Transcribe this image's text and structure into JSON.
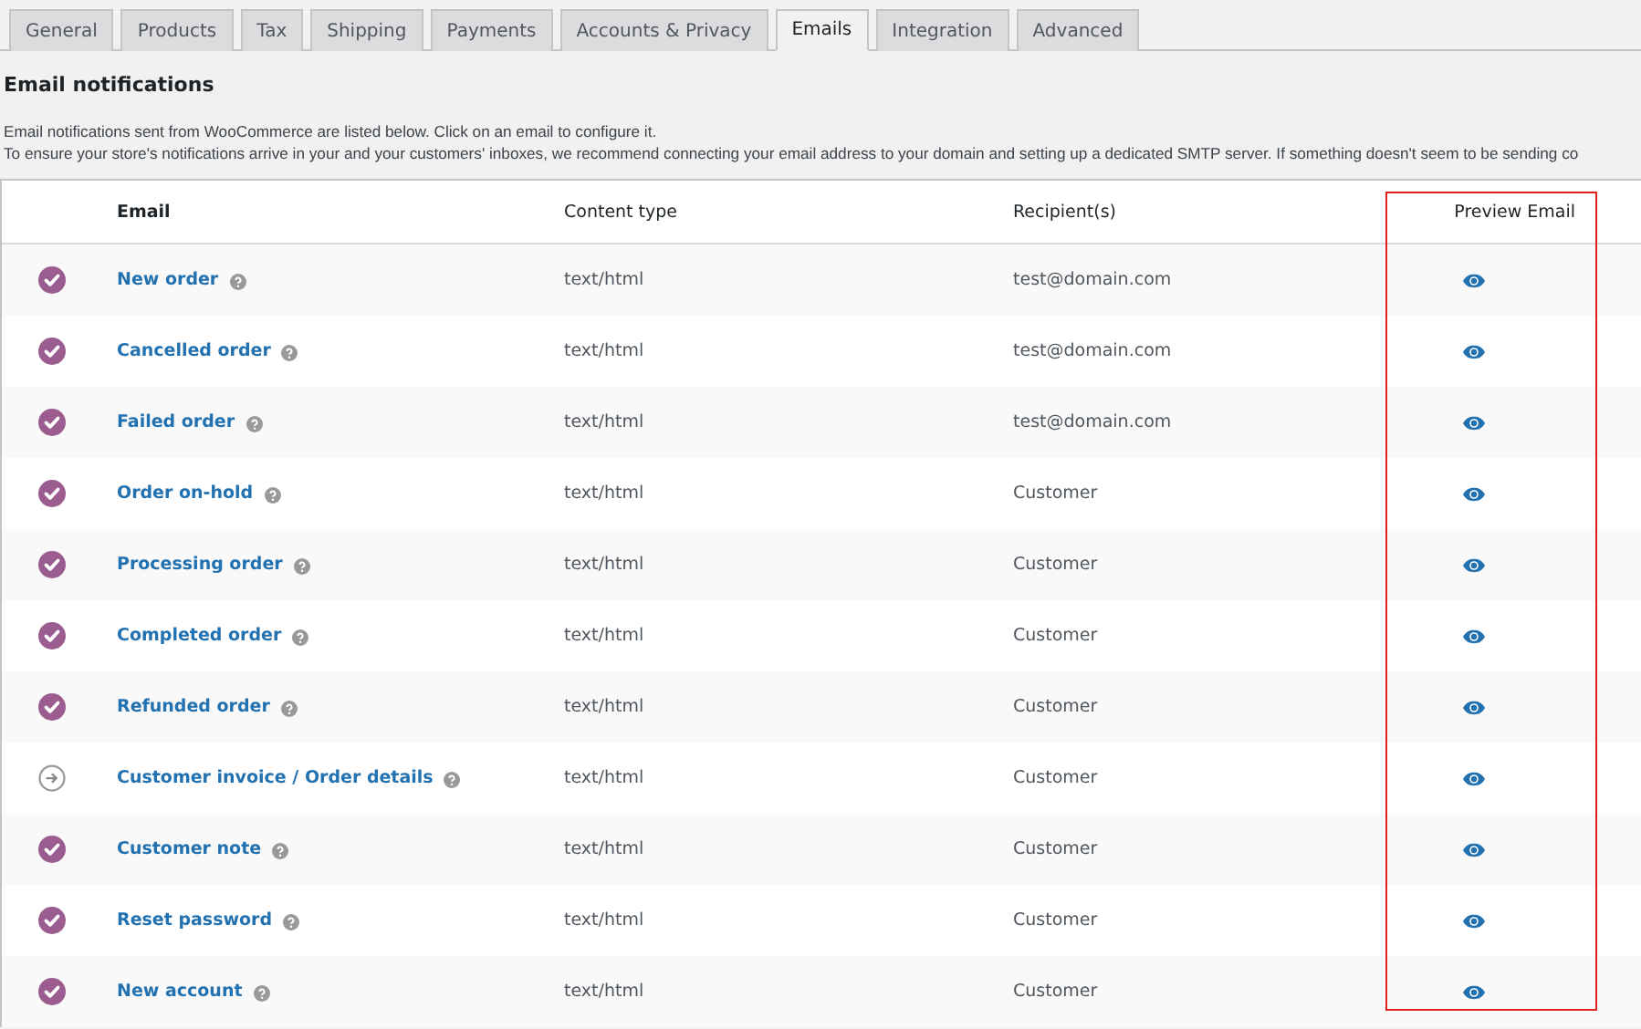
{
  "tabs": [
    {
      "label": "General",
      "selected": false
    },
    {
      "label": "Products",
      "selected": false
    },
    {
      "label": "Tax",
      "selected": false
    },
    {
      "label": "Shipping",
      "selected": false
    },
    {
      "label": "Payments",
      "selected": false
    },
    {
      "label": "Accounts & Privacy",
      "selected": false
    },
    {
      "label": "Emails",
      "selected": true
    },
    {
      "label": "Integration",
      "selected": false
    },
    {
      "label": "Advanced",
      "selected": false
    }
  ],
  "heading": "Email notifications",
  "description": [
    "Email notifications sent from WooCommerce are listed below. Click on an email to configure it.",
    "To ensure your store's notifications arrive in your and your customers' inboxes, we recommend connecting your email address to your domain and setting up a dedicated SMTP server. If something doesn't seem to be sending co"
  ],
  "table": {
    "columns": [
      {
        "label": "Email",
        "highlighted": false
      },
      {
        "label": "Content type",
        "highlighted": false
      },
      {
        "label": "Recipient(s)",
        "highlighted": false
      },
      {
        "label": "Preview Email",
        "highlighted": true
      }
    ],
    "rows": [
      {
        "kind": "enabled",
        "email": "New order",
        "content_type": "text/html",
        "recipient": "test@domain.com"
      },
      {
        "kind": "enabled",
        "email": "Cancelled order",
        "content_type": "text/html",
        "recipient": "test@domain.com"
      },
      {
        "kind": "enabled",
        "email": "Failed order",
        "content_type": "text/html",
        "recipient": "test@domain.com"
      },
      {
        "kind": "enabled",
        "email": "Order on-hold",
        "content_type": "text/html",
        "recipient": "Customer"
      },
      {
        "kind": "enabled",
        "email": "Processing order",
        "content_type": "text/html",
        "recipient": "Customer"
      },
      {
        "kind": "enabled",
        "email": "Completed order",
        "content_type": "text/html",
        "recipient": "Customer"
      },
      {
        "kind": "enabled",
        "email": "Refunded order",
        "content_type": "text/html",
        "recipient": "Customer"
      },
      {
        "kind": "manual",
        "email": "Customer invoice / Order details",
        "content_type": "text/html",
        "recipient": "Customer"
      },
      {
        "kind": "enabled",
        "email": "Customer note",
        "content_type": "text/html",
        "recipient": "Customer"
      },
      {
        "kind": "enabled",
        "email": "Reset password",
        "content_type": "text/html",
        "recipient": "Customer"
      },
      {
        "kind": "enabled",
        "email": "New account",
        "content_type": "text/html",
        "recipient": "Customer"
      }
    ]
  }
}
